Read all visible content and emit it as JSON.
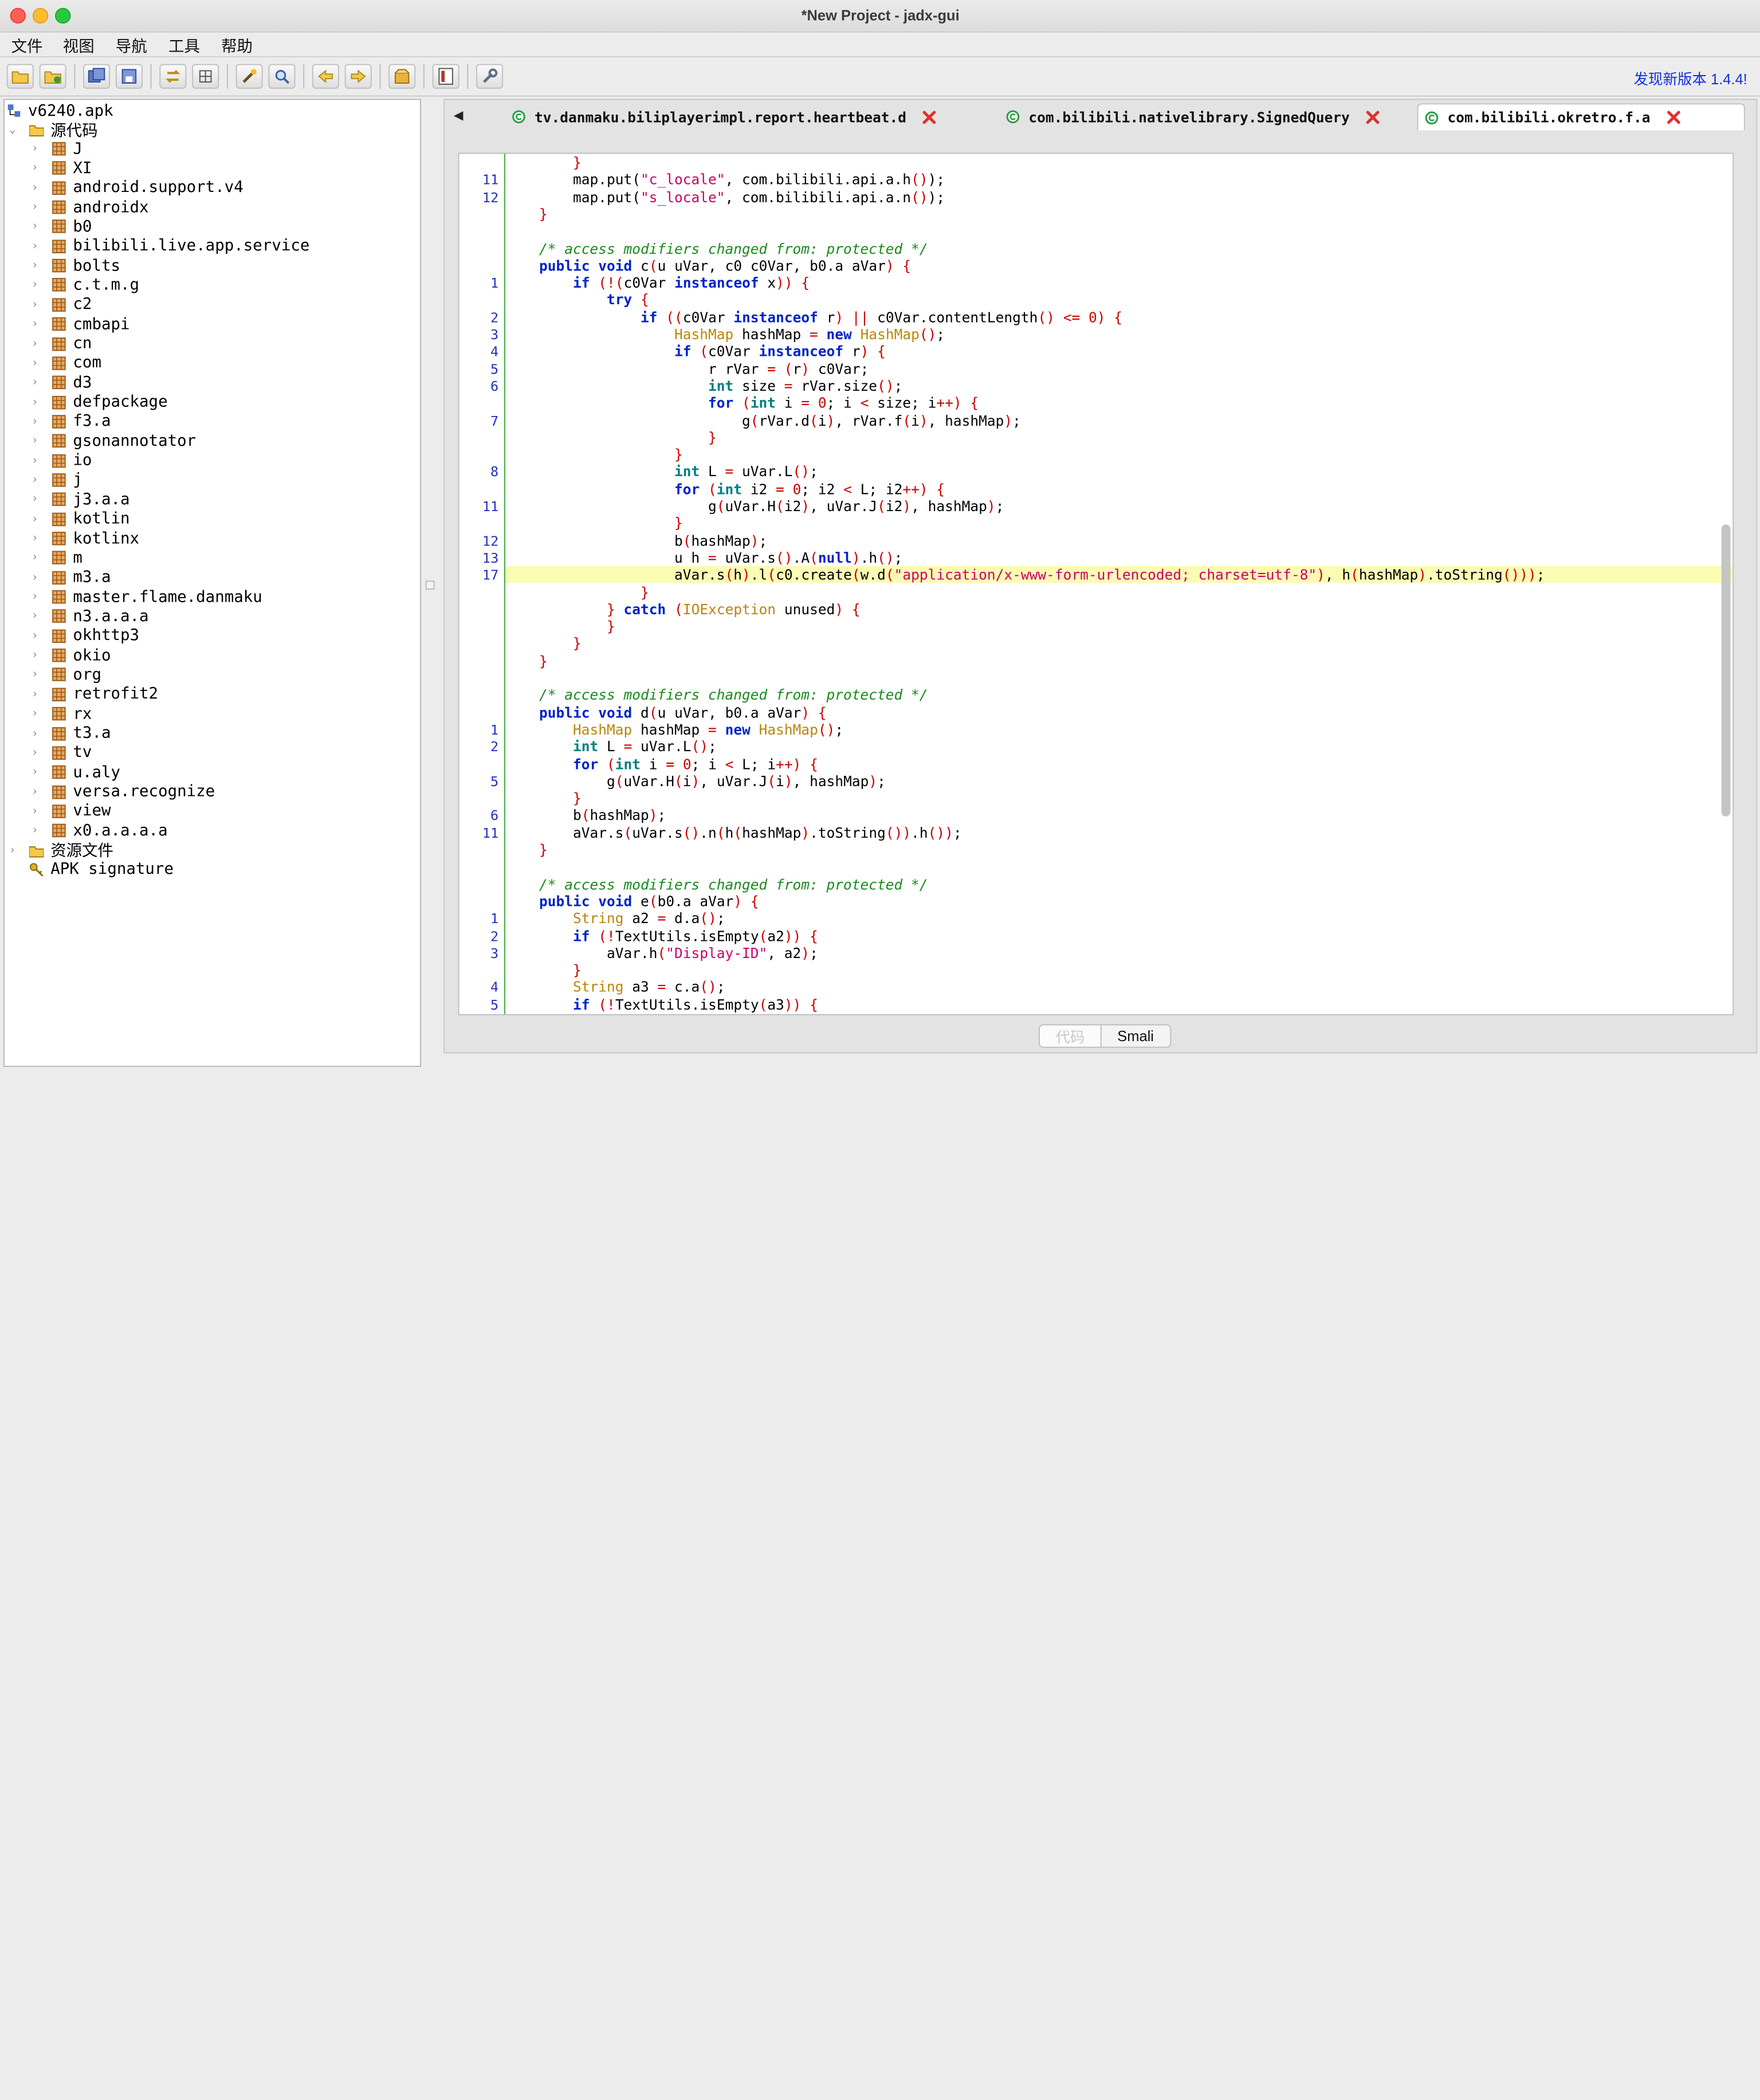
{
  "window": {
    "title": "*New Project - jadx-gui"
  },
  "menubar": {
    "items": [
      "文件",
      "视图",
      "导航",
      "工具",
      "帮助"
    ]
  },
  "toolbar": {
    "update_text": "发现新版本 1.4.4!"
  },
  "tree": {
    "root": "v6240.apk",
    "source_node": "源代码",
    "packages": [
      "J",
      "XI",
      "android.support.v4",
      "androidx",
      "b0",
      "bilibili.live.app.service",
      "bolts",
      "c.t.m.g",
      "c2",
      "cmbapi",
      "cn",
      "com",
      "d3",
      "defpackage",
      "f3.a",
      "gsonannotator",
      "io",
      "j",
      "j3.a.a",
      "kotlin",
      "kotlinx",
      "m",
      "m3.a",
      "master.flame.danmaku",
      "n3.a.a.a",
      "okhttp3",
      "okio",
      "org",
      "retrofit2",
      "rx",
      "t3.a",
      "tv",
      "u.aly",
      "versa.recognize",
      "view",
      "x0.a.a.a.a"
    ],
    "resources_node": "资源文件",
    "signature_node": "APK signature"
  },
  "tabs": [
    {
      "label": "tv.danmaku.biliplayerimpl.report.heartbeat.d",
      "active": false
    },
    {
      "label": "com.bilibili.nativelibrary.SignedQuery",
      "active": false
    },
    {
      "label": "com.bilibili.okretro.f.a",
      "active": true
    }
  ],
  "code": {
    "lines": [
      {
        "n": "",
        "html": "        <span class=\"op\">}</span>"
      },
      {
        "n": "11",
        "html": "        map.put(<span class=\"st\">\"c_locale\"</span>, com.bilibili.api.a.h<span class=\"op\">()</span>);"
      },
      {
        "n": "12",
        "html": "        map.put(<span class=\"st\">\"s_locale\"</span>, com.bilibili.api.a.n<span class=\"op\">()</span>);"
      },
      {
        "n": "",
        "html": "    <span class=\"op\">}</span>"
      },
      {
        "n": "",
        "html": ""
      },
      {
        "n": "",
        "html": "    <span class=\"cm\">/* access modifiers changed from: protected */</span>"
      },
      {
        "n": "",
        "html": "    <span class=\"kw\">public</span> <span class=\"kw\">void</span> c<span class=\"op\">(</span>u uVar, c0 c0Var, b0.a aVar<span class=\"op\">)</span> <span class=\"op\">{</span>"
      },
      {
        "n": "1",
        "html": "        <span class=\"kw\">if</span> <span class=\"op\">(!(</span>c0Var <span class=\"kw\">instanceof</span> x<span class=\"op\">))</span> <span class=\"op\">{</span>"
      },
      {
        "n": "",
        "html": "            <span class=\"kw\">try</span> <span class=\"op\">{</span>"
      },
      {
        "n": "2",
        "html": "                <span class=\"kw\">if</span> <span class=\"op\">((</span>c0Var <span class=\"kw\">instanceof</span> r<span class=\"op\">)</span> <span class=\"op\">||</span> c0Var.contentLength<span class=\"op\">()</span> <span class=\"op\">&lt;=</span> <span class=\"nu\">0</span><span class=\"op\">)</span> <span class=\"op\">{</span>"
      },
      {
        "n": "3",
        "html": "                    <span class=\"ty\">HashMap</span> hashMap <span class=\"op\">=</span> <span class=\"kw\">new</span> <span class=\"ty\">HashMap</span><span class=\"op\">()</span>;"
      },
      {
        "n": "4",
        "html": "                    <span class=\"kw\">if</span> <span class=\"op\">(</span>c0Var <span class=\"kw\">instanceof</span> r<span class=\"op\">)</span> <span class=\"op\">{</span>"
      },
      {
        "n": "5",
        "html": "                        r rVar <span class=\"op\">=</span> <span class=\"op\">(</span>r<span class=\"op\">)</span> c0Var;"
      },
      {
        "n": "6",
        "html": "                        <span class=\"kw\" style=\"color:#008080\">int</span> size <span class=\"op\">=</span> rVar.size<span class=\"op\">()</span>;"
      },
      {
        "n": "",
        "html": "                        <span class=\"kw\">for</span> <span class=\"op\">(</span><span class=\"kw\" style=\"color:#008080\">int</span> i <span class=\"op\">=</span> <span class=\"nu\">0</span>; i <span class=\"op\">&lt;</span> size; i<span class=\"op\">++)</span> <span class=\"op\">{</span>"
      },
      {
        "n": "7",
        "html": "                            g<span class=\"op\">(</span>rVar.d<span class=\"op\">(</span>i<span class=\"op\">)</span>, rVar.f<span class=\"op\">(</span>i<span class=\"op\">)</span>, hashMap<span class=\"op\">)</span>;"
      },
      {
        "n": "",
        "html": "                        <span class=\"op\">}</span>"
      },
      {
        "n": "",
        "html": "                    <span class=\"op\">}</span>"
      },
      {
        "n": "8",
        "html": "                    <span class=\"kw\" style=\"color:#008080\">int</span> L <span class=\"op\">=</span> uVar.L<span class=\"op\">()</span>;"
      },
      {
        "n": "",
        "html": "                    <span class=\"kw\">for</span> <span class=\"op\">(</span><span class=\"kw\" style=\"color:#008080\">int</span> i2 <span class=\"op\">=</span> <span class=\"nu\">0</span>; i2 <span class=\"op\">&lt;</span> L; i2<span class=\"op\">++)</span> <span class=\"op\">{</span>"
      },
      {
        "n": "11",
        "html": "                        g<span class=\"op\">(</span>uVar.H<span class=\"op\">(</span>i2<span class=\"op\">)</span>, uVar.J<span class=\"op\">(</span>i2<span class=\"op\">)</span>, hashMap<span class=\"op\">)</span>;"
      },
      {
        "n": "",
        "html": "                    <span class=\"op\">}</span>"
      },
      {
        "n": "12",
        "html": "                    b<span class=\"op\">(</span>hashMap<span class=\"op\">)</span>;"
      },
      {
        "n": "13",
        "html": "                    u h <span class=\"op\">=</span> uVar.s<span class=\"op\">()</span>.A<span class=\"op\">(</span><span class=\"kw\">null</span><span class=\"op\">)</span>.h<span class=\"op\">()</span>;"
      },
      {
        "n": "17",
        "hl": true,
        "html": "                    aVar.s<span class=\"op\">(</span>h<span class=\"op\">)</span>.l<span class=\"op\">(</span>c0.create<span class=\"op\">(</span>w.d<span class=\"op\">(</span><span class=\"st\">\"application/x-www-form-urlencoded; charset=utf-8\"</span><span class=\"op\">)</span>, h<span class=\"op\">(</span>hashMap<span class=\"op\">)</span>.toString<span class=\"op\">()))</span>;"
      },
      {
        "n": "",
        "html": "                <span class=\"op\">}</span>"
      },
      {
        "n": "",
        "html": "            <span class=\"op\">}</span> <span class=\"kw\">catch</span> <span class=\"op\">(</span><span class=\"ty\">IOException</span> unused<span class=\"op\">)</span> <span class=\"op\">{</span>"
      },
      {
        "n": "",
        "html": "            <span class=\"op\">}</span>"
      },
      {
        "n": "",
        "html": "        <span class=\"op\">}</span>"
      },
      {
        "n": "",
        "html": "    <span class=\"op\">}</span>"
      },
      {
        "n": "",
        "html": ""
      },
      {
        "n": "",
        "html": "    <span class=\"cm\">/* access modifiers changed from: protected */</span>"
      },
      {
        "n": "",
        "html": "    <span class=\"kw\">public</span> <span class=\"kw\">void</span> d<span class=\"op\">(</span>u uVar, b0.a aVar<span class=\"op\">)</span> <span class=\"op\">{</span>"
      },
      {
        "n": "1",
        "html": "        <span class=\"ty\">HashMap</span> hashMap <span class=\"op\">=</span> <span class=\"kw\">new</span> <span class=\"ty\">HashMap</span><span class=\"op\">()</span>;"
      },
      {
        "n": "2",
        "html": "        <span class=\"kw\" style=\"color:#008080\">int</span> L <span class=\"op\">=</span> uVar.L<span class=\"op\">()</span>;"
      },
      {
        "n": "",
        "html": "        <span class=\"kw\">for</span> <span class=\"op\">(</span><span class=\"kw\" style=\"color:#008080\">int</span> i <span class=\"op\">=</span> <span class=\"nu\">0</span>; i <span class=\"op\">&lt;</span> L; i<span class=\"op\">++)</span> <span class=\"op\">{</span>"
      },
      {
        "n": "5",
        "html": "            g<span class=\"op\">(</span>uVar.H<span class=\"op\">(</span>i<span class=\"op\">)</span>, uVar.J<span class=\"op\">(</span>i<span class=\"op\">)</span>, hashMap<span class=\"op\">)</span>;"
      },
      {
        "n": "",
        "html": "        <span class=\"op\">}</span>"
      },
      {
        "n": "6",
        "html": "        b<span class=\"op\">(</span>hashMap<span class=\"op\">)</span>;"
      },
      {
        "n": "11",
        "html": "        aVar.s<span class=\"op\">(</span>uVar.s<span class=\"op\">()</span>.n<span class=\"op\">(</span>h<span class=\"op\">(</span>hashMap<span class=\"op\">)</span>.toString<span class=\"op\">())</span>.h<span class=\"op\">())</span>;"
      },
      {
        "n": "",
        "html": "    <span class=\"op\">}</span>"
      },
      {
        "n": "",
        "html": ""
      },
      {
        "n": "",
        "html": "    <span class=\"cm\">/* access modifiers changed from: protected */</span>"
      },
      {
        "n": "",
        "html": "    <span class=\"kw\">public</span> <span class=\"kw\">void</span> e<span class=\"op\">(</span>b0.a aVar<span class=\"op\">)</span> <span class=\"op\">{</span>"
      },
      {
        "n": "1",
        "html": "        <span class=\"ty\">String</span> a2 <span class=\"op\">=</span> d.a<span class=\"op\">()</span>;"
      },
      {
        "n": "2",
        "html": "        <span class=\"kw\">if</span> <span class=\"op\">(!</span>TextUtils.isEmpty<span class=\"op\">(</span>a2<span class=\"op\">))</span> <span class=\"op\">{</span>"
      },
      {
        "n": "3",
        "html": "            aVar.h<span class=\"op\">(</span><span class=\"st\">\"Display-ID\"</span>, a2<span class=\"op\">)</span>;"
      },
      {
        "n": "",
        "html": "        <span class=\"op\">}</span>"
      },
      {
        "n": "4",
        "html": "        <span class=\"ty\">String</span> a3 <span class=\"op\">=</span> c.a<span class=\"op\">()</span>;"
      },
      {
        "n": "5",
        "html": "        <span class=\"kw\">if</span> <span class=\"op\">(!</span>TextUtils.isEmpty<span class=\"op\">(</span>a3<span class=\"op\">))</span> <span class=\"op\">{</span>"
      }
    ]
  },
  "bottom_tabs": {
    "code": "代码",
    "smali": "Smali"
  }
}
